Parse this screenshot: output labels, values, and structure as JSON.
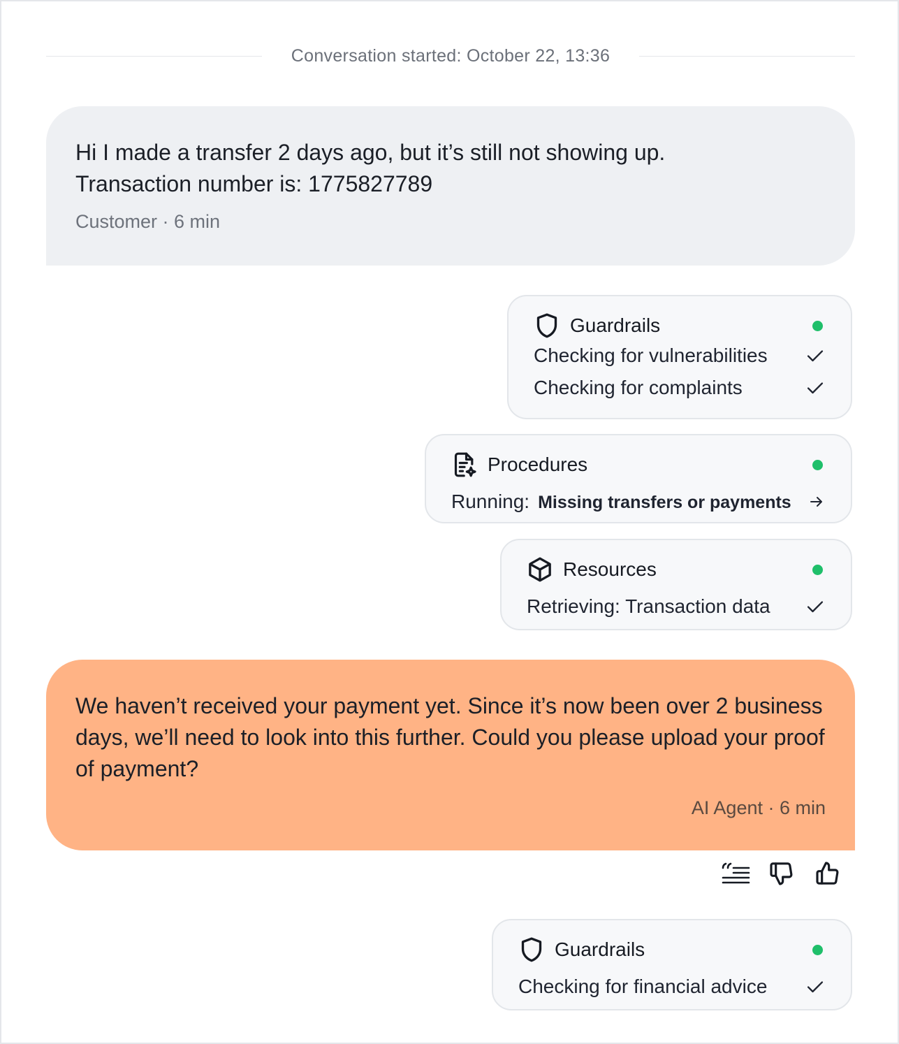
{
  "conversation": {
    "started_label": "Conversation started: October 22, 13:36"
  },
  "messages": [
    {
      "role": "customer",
      "text_line1": "Hi I made a transfer 2 days ago, but it’s still not showing up.",
      "text_line2": "Transaction number is: 1775827789",
      "meta": "Customer · 6 min"
    },
    {
      "role": "agent",
      "text": "We haven’t received your payment yet. Since it’s now been over 2 business days, we’ll need to look into this further. Could you please upload your proof of payment?",
      "meta": "AI Agent · 6 min"
    }
  ],
  "cards": {
    "guardrails_1": {
      "title": "Guardrails",
      "icon": "shield-icon",
      "status_color": "#1fbf6a",
      "items": [
        "Checking for vulnerabilities",
        "Checking for complaints"
      ]
    },
    "procedures": {
      "title": "Procedures",
      "icon": "document-sparkle-icon",
      "status_color": "#1fbf6a",
      "running_label": "Running:",
      "running_value": "Missing transfers or payments"
    },
    "resources": {
      "title": "Resources",
      "icon": "cube-icon",
      "status_color": "#1fbf6a",
      "item": "Retrieving: Transaction data"
    },
    "guardrails_2": {
      "title": "Guardrails",
      "icon": "shield-icon",
      "status_color": "#1fbf6a",
      "item": "Checking for financial advice"
    }
  },
  "actions": [
    "quote-icon",
    "thumbs-down-icon",
    "thumbs-up-icon"
  ],
  "colors": {
    "customer_bubble": "#eef0f3",
    "agent_bubble": "#ffb385",
    "status_dot": "#1fbf6a"
  }
}
